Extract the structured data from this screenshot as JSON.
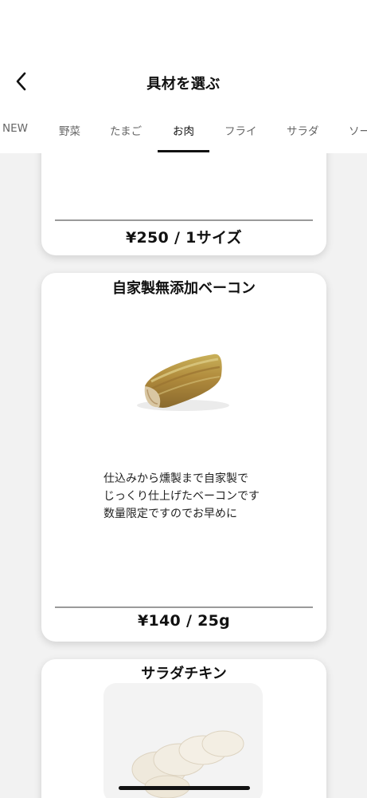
{
  "header": {
    "back_icon": "chevron-left-icon",
    "title": "具材を選ぶ"
  },
  "tabs": [
    {
      "label": "NEW"
    },
    {
      "label": "野菜"
    },
    {
      "label": "たまご"
    },
    {
      "label": "お肉",
      "active": true
    },
    {
      "label": "フライ"
    },
    {
      "label": "サラダ"
    },
    {
      "label": "ソー"
    }
  ],
  "items": [
    {
      "price": "¥250 / 1サイズ"
    },
    {
      "name": "自家製無添加ベーコン",
      "image": "bacon-photo",
      "description": [
        "仕込みから燻製まで自家製で",
        "じっくり仕上げたベーコンです",
        "数量限定ですのでお早めに"
      ],
      "price": "¥140 / 25g"
    },
    {
      "name": "サラダチキン",
      "image": "salad-chicken-photo"
    }
  ],
  "colors": {
    "accent": "#111111",
    "tab_inactive": "#666666",
    "background": "#f2f2f2"
  }
}
